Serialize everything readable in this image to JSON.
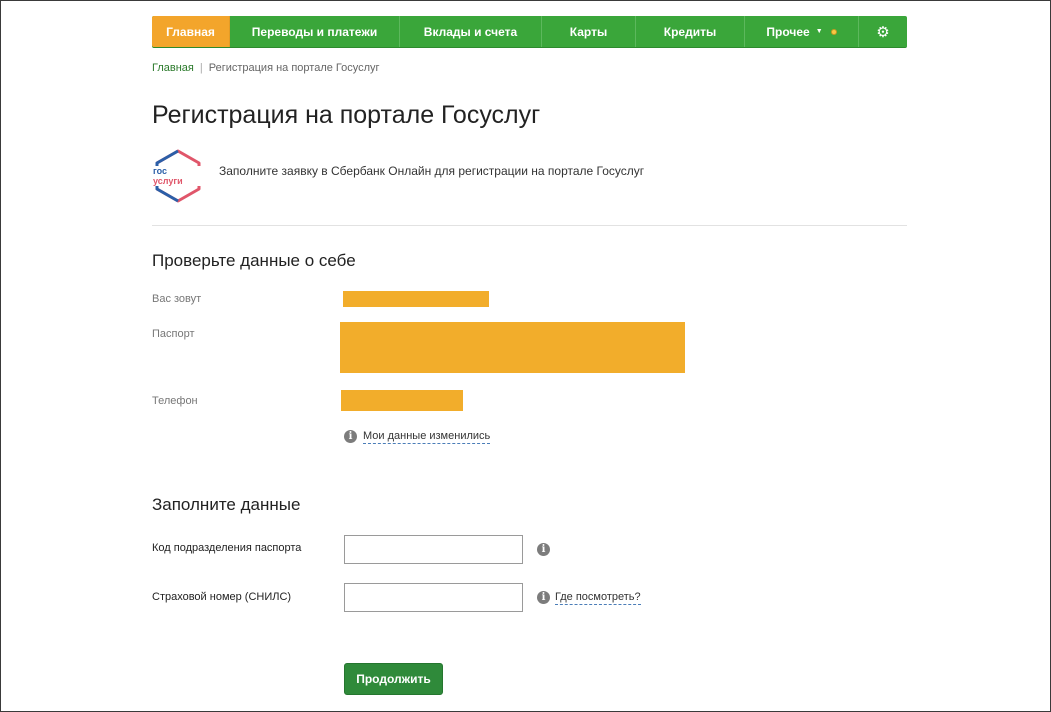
{
  "nav": {
    "items": [
      {
        "label": "Главная",
        "active": true
      },
      {
        "label": "Переводы и платежи"
      },
      {
        "label": "Вклады и счета"
      },
      {
        "label": "Карты"
      },
      {
        "label": "Кредиты"
      },
      {
        "label": "Прочее"
      }
    ],
    "settings_icon": "gear-icon",
    "accent": "#f3a52b",
    "background": "#3aa63a"
  },
  "breadcrumb": {
    "home": "Главная",
    "current": "Регистрация на портале Госуслуг"
  },
  "page_title": "Регистрация на портале Госуслуг",
  "info": {
    "logo_line1": "гос",
    "logo_line2": "услуги",
    "text": "Заполните заявку в Сбербанк Онлайн для регистрации на портале Госуслуг"
  },
  "check_section": {
    "title": "Проверьте данные о себе",
    "name_label": "Вас зовут",
    "passport_label": "Паспорт",
    "phone_label": "Телефон",
    "changed_link": "Мои данные изменились",
    "redact_color": "#f2ad2b"
  },
  "fill_section": {
    "title": "Заполните данные",
    "passport_code_label": "Код подразделения паспорта",
    "passport_code_value": "",
    "snils_label": "Страховой номер (СНИЛС)",
    "snils_value": "",
    "where_link": "Где посмотреть?"
  },
  "submit_label": "Продолжить"
}
